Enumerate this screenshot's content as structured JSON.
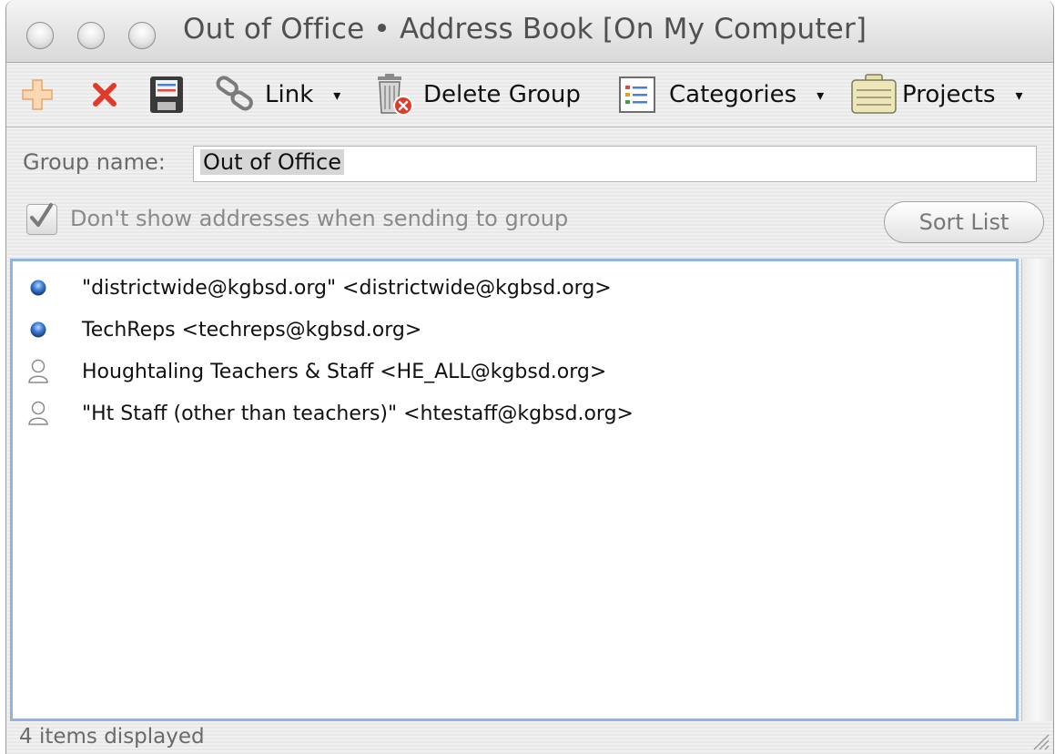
{
  "window": {
    "title": "Out of Office • Address Book [On My Computer]"
  },
  "toolbar": {
    "items": [
      {
        "icon": "plus-icon",
        "label": ""
      },
      {
        "icon": "delete-x-icon",
        "label": ""
      },
      {
        "icon": "save-icon",
        "label": ""
      },
      {
        "icon": "link-icon",
        "label": "Link",
        "menu": "▾"
      },
      {
        "icon": "trash-delete-icon",
        "label": "Delete Group"
      },
      {
        "icon": "categories-icon",
        "label": "Categories",
        "menu": "▾"
      },
      {
        "icon": "projects-icon",
        "label": "Projects",
        "menu": "▾"
      }
    ]
  },
  "form": {
    "group_name_label": "Group name:",
    "group_name_value": "Out of Office",
    "hide_addresses_label": "Don't show addresses when sending to group",
    "hide_addresses_checked": true,
    "sort_button_label": "Sort List"
  },
  "members": [
    {
      "icon": "blue-dot-icon",
      "text": "\"districtwide@kgbsd.org\" <districtwide@kgbsd.org>"
    },
    {
      "icon": "blue-dot-icon",
      "text": "TechReps <techreps@kgbsd.org>"
    },
    {
      "icon": "person-icon",
      "text": "Houghtaling Teachers & Staff <HE_ALL@kgbsd.org>"
    },
    {
      "icon": "person-icon",
      "text": "\"Ht Staff (other than teachers)\" <htestaff@kgbsd.org>"
    }
  ],
  "status": {
    "text": "4 items displayed"
  },
  "colors": {
    "selection_border": "#8fb4e0",
    "delete_red": "#e03b2a",
    "add_orange": "#f5b87a"
  }
}
